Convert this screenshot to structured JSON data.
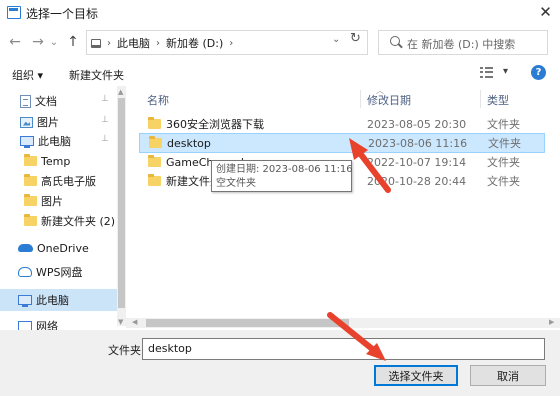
{
  "window": {
    "title": "选择一个目标",
    "close": "✕"
  },
  "nav": {
    "back": "←",
    "forward": "→",
    "recent": "⌄",
    "up": "↑",
    "breadcrumb": [
      "此电脑",
      "新加卷 (D:)"
    ],
    "refresh": "↻",
    "search_placeholder": "在 新加卷 (D:) 中搜索"
  },
  "toolbar": {
    "organize": "组织 ▾",
    "new_folder": "新建文件夹",
    "help": "?"
  },
  "sidebar": {
    "items": [
      {
        "label": "文档",
        "icon": "document-icon",
        "pinned": true
      },
      {
        "label": "图片",
        "icon": "picture-icon",
        "pinned": true
      },
      {
        "label": "此电脑",
        "icon": "computer-icon",
        "pinned": true
      },
      {
        "label": "Temp",
        "icon": "folder-icon"
      },
      {
        "label": "高氏电子版",
        "icon": "folder-icon"
      },
      {
        "label": "图片",
        "icon": "folder-icon"
      },
      {
        "label": "新建文件夹 (2)",
        "icon": "folder-icon"
      },
      {
        "label": "OneDrive",
        "icon": "cloud-icon"
      },
      {
        "label": "WPS网盘",
        "icon": "cloud-drive-icon"
      },
      {
        "label": "此电脑",
        "icon": "computer-icon",
        "selected": true
      },
      {
        "label": "网络",
        "icon": "network-icon"
      }
    ],
    "pin_glyph": "📌"
  },
  "file_list": {
    "columns": [
      "名称",
      "修改日期",
      "类型"
    ],
    "rows": [
      {
        "name": "360安全浏览器下载",
        "date": "2023-08-05 20:30",
        "type": "文件夹"
      },
      {
        "name": "desktop",
        "date": "2023-08-06 11:16",
        "type": "文件夹",
        "selected": true
      },
      {
        "name": "GameChannel",
        "date": "2022-10-07 19:14",
        "type": "文件夹"
      },
      {
        "name": "新建文件夹",
        "date": "2020-10-28 20:44",
        "type": "文件夹"
      }
    ]
  },
  "tooltip": {
    "line1": "创建日期: 2023-08-06 11:16",
    "line2": "空文件夹"
  },
  "footer": {
    "folder_label": "文件夹:",
    "folder_value": "desktop",
    "select_button": "选择文件夹",
    "cancel_button": "取消"
  },
  "colors": {
    "accent": "#0078d7",
    "selection": "#cce8ff",
    "arrow": "#e8412c"
  }
}
